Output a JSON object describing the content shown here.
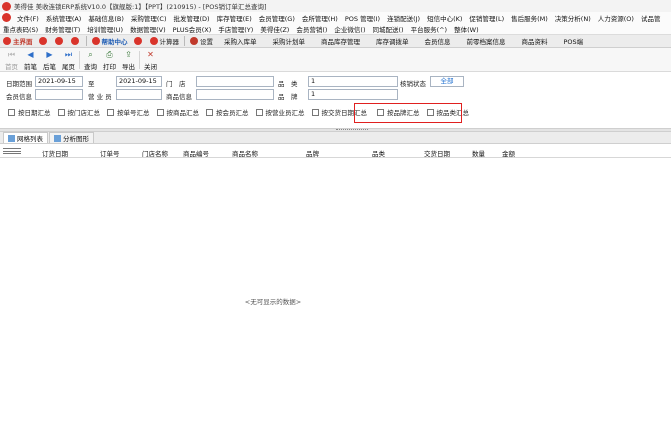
{
  "window": {
    "title": "美得佳 美收连锁ERP系统V10.0【旗舰版:1】【PPT】(210915) - [POS销订单汇总查询]"
  },
  "menu": {
    "row1": [
      "文件(F)",
      "系统管理(A)",
      "基础信息(B)",
      "采购管理(C)",
      "批发管理(D)",
      "库存管理(E)",
      "会员管理(G)",
      "会所管理(H)",
      "POS 管理(I)",
      "连锁配送(J)",
      "短信中心(K)",
      "促销管理(L)",
      "售后服务(M)",
      "决策分析(N)",
      "人力资源(O)",
      "试品管"
    ],
    "row2": [
      "重点表码(S)",
      "财务管理(T)",
      "培训管理(U)",
      "数据管理(V)",
      "PLUS会员(X)",
      "手店管理(Y)",
      "美得佳(Z)",
      "会员营销()",
      "企业微信()",
      "同城配送()",
      "平台服务(^)",
      "整体(W)"
    ]
  },
  "quickbar": {
    "home": "主界面",
    "help": "帮助中心",
    "calculator": "计算器",
    "settings": "设置",
    "tabs": [
      "采购入库单",
      "采购计划单",
      "商品库存管理",
      "库存调拨单",
      "会员信息",
      "前零档案信息",
      "商品资料",
      "POS端"
    ]
  },
  "toolbar": {
    "buttons": [
      {
        "label": "首页",
        "icon": "first-page-icon",
        "glyph": "⏮",
        "disabled": true
      },
      {
        "label": "前笔",
        "icon": "prev-icon",
        "glyph": "◀",
        "disabled": false
      },
      {
        "label": "后笔",
        "icon": "next-icon",
        "glyph": "▶",
        "disabled": false
      },
      {
        "label": "尾页",
        "icon": "last-page-icon",
        "glyph": "⏭",
        "disabled": false
      },
      {
        "label": "查询",
        "icon": "query-icon",
        "glyph": "⌕",
        "disabled": false
      },
      {
        "label": "打印",
        "icon": "print-icon",
        "glyph": "⎙",
        "disabled": false
      },
      {
        "label": "导出",
        "icon": "export-icon",
        "glyph": "⇪",
        "disabled": false
      },
      {
        "label": "关闭",
        "icon": "close-icon",
        "glyph": "✕",
        "disabled": false
      }
    ]
  },
  "filters": {
    "date_range_label": "日期范围",
    "date_from": "2021-09-15",
    "to_label": "至",
    "date_to": "2021-09-15",
    "store_label": "门　店",
    "store_value": "",
    "category_label": "品　类",
    "category_value": "1",
    "verify_status_label": "核销状态",
    "verify_status_value": "全部",
    "member_label": "会员信息",
    "member_value": "",
    "sales_label": "营 业 员",
    "sales_value": "",
    "product_label": "商品信息",
    "product_value": "",
    "brand_label": "品　牌",
    "brand_value": "1"
  },
  "summary_options": [
    {
      "label": "按日期汇总",
      "checked": false
    },
    {
      "label": "按门店汇总",
      "checked": false
    },
    {
      "label": "按单号汇总",
      "checked": false
    },
    {
      "label": "按商品汇总",
      "checked": false
    },
    {
      "label": "按会员汇总",
      "checked": false
    },
    {
      "label": "按营业员汇总",
      "checked": false
    },
    {
      "label": "按交货日期汇总",
      "checked": false
    },
    {
      "label": "按品牌汇总",
      "checked": false
    },
    {
      "label": "按品类汇总",
      "checked": false
    }
  ],
  "tabs": [
    "网格列表",
    "分析图形"
  ],
  "grid": {
    "columns": [
      "订货日期",
      "订单号",
      "门店名称",
      "商品编号",
      "商品名称",
      "品牌",
      "品类",
      "交货日期",
      "数量",
      "金额"
    ],
    "empty_message": "<无可显示的数据>"
  },
  "colors": {
    "highlight_border": "#e0201f",
    "brand_red": "#d9342b",
    "help_blue": "#1f5db5"
  }
}
